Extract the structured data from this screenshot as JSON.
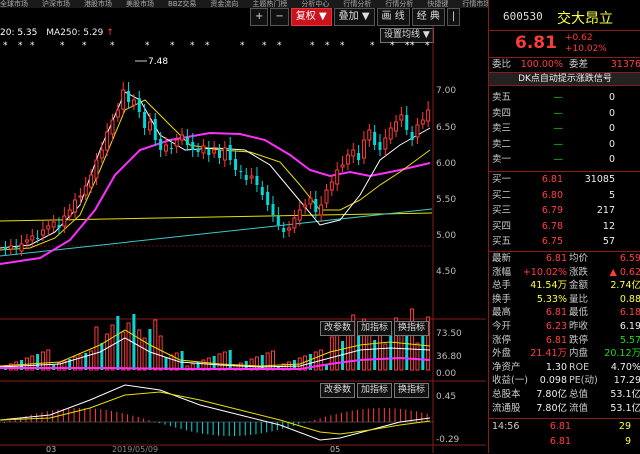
{
  "menu": [
    "全球市场",
    "沪深市场",
    "港股市场",
    "美股市场",
    "BBZ交易",
    "资金流向",
    "主题热门榜",
    "分析中心",
    "行情分析",
    "行情分析",
    "快捷键",
    "行情市场"
  ],
  "toolbar": {
    "plus": "+",
    "minus": "−",
    "fuquan": "复权",
    "diejia": "叠加",
    "huaxian": "画 线",
    "jingdian": "经 典",
    "lipin": "|"
  },
  "ma_legend": {
    "ma20": "20: 5.35",
    "ma250": "MA250: 5.29",
    "arrow": "↑"
  },
  "buttons": {
    "setting_ma": "设置均线",
    "change_param": "改参数",
    "add_indicator": "加指标",
    "switch_indicator": "换指标"
  },
  "price_axis": [
    "7.00",
    "6.50",
    "6.00",
    "5.50",
    "5.00",
    "4.50"
  ],
  "volume_axis": [
    "73.50",
    "36.80",
    "0.00"
  ],
  "macd_axis": [
    "0.45",
    "-0.29"
  ],
  "date_labels": [
    "03",
    "2019/05/09",
    "05"
  ],
  "high_label": "7.48",
  "stock": {
    "code": "600530",
    "name": "交大昂立",
    "price": "6.81",
    "change": "+0.62",
    "pct": "+10.02%"
  },
  "ratio_row": {
    "label1": "委比",
    "val1": "100.00%",
    "label2": "委差",
    "val2": "31376"
  },
  "signal_banner": "DK点自动提示涨跌信号",
  "sell_rows": [
    {
      "label": "卖五",
      "price": "—",
      "vol": "0"
    },
    {
      "label": "卖四",
      "price": "—",
      "vol": "0"
    },
    {
      "label": "卖三",
      "price": "—",
      "vol": "0"
    },
    {
      "label": "卖二",
      "price": "—",
      "vol": "0"
    },
    {
      "label": "卖一",
      "price": "—",
      "vol": "0"
    }
  ],
  "buy_rows": [
    {
      "label": "买一",
      "price": "6.81",
      "vol": "31085"
    },
    {
      "label": "买二",
      "price": "6.80",
      "vol": "5"
    },
    {
      "label": "买三",
      "price": "6.79",
      "vol": "217"
    },
    {
      "label": "买四",
      "price": "6.78",
      "vol": "12"
    },
    {
      "label": "买五",
      "price": "6.75",
      "vol": "57"
    }
  ],
  "stats": [
    {
      "l1": "最新",
      "v1": "6.81",
      "c1": "red",
      "l2": "均价",
      "v2": "6.59",
      "c2": "red"
    },
    {
      "l1": "涨幅",
      "v1": "+10.02%",
      "c1": "red",
      "l2": "涨跌",
      "v2": "▲ 0.62",
      "c2": "red"
    },
    {
      "l1": "总手",
      "v1": "41.54万",
      "c1": "yellow",
      "l2": "金额",
      "v2": "2.74亿",
      "c2": "yellow"
    },
    {
      "l1": "换手",
      "v1": "5.33%",
      "c1": "yellow",
      "l2": "量比",
      "v2": "0.88",
      "c2": "yellow"
    },
    {
      "l1": "最高",
      "v1": "6.81",
      "c1": "red",
      "l2": "最低",
      "v2": "6.18",
      "c2": "red"
    },
    {
      "l1": "今开",
      "v1": "6.23",
      "c1": "red",
      "l2": "昨收",
      "v2": "6.19",
      "c2": "white"
    },
    {
      "l1": "涨停",
      "v1": "6.81",
      "c1": "red",
      "l2": "跌停",
      "v2": "5.57",
      "c2": "green"
    },
    {
      "l1": "外盘",
      "v1": "21.41万",
      "c1": "red",
      "l2": "内盘",
      "v2": "20.12万",
      "c2": "green"
    },
    {
      "l1": "净资产",
      "v1": "1.30",
      "c1": "white",
      "l2": "ROE",
      "v2": "4.70%",
      "c2": "white"
    },
    {
      "l1": "收益(一)",
      "v1": "0.098",
      "c1": "white",
      "l2": "PE(动)",
      "v2": "17.29",
      "c2": "white"
    },
    {
      "l1": "总股本",
      "v1": "7.80亿",
      "c1": "white",
      "l2": "总值",
      "v2": "53.1亿",
      "c2": "white"
    },
    {
      "l1": "流通股",
      "v1": "7.80亿",
      "c1": "white",
      "l2": "流值",
      "v2": "53.1亿",
      "c2": "white"
    }
  ],
  "ticks": [
    {
      "time": "14:56",
      "price": "6.81",
      "vol": "29"
    },
    {
      "time": "",
      "price": "6.81",
      "vol": "9"
    }
  ],
  "colors": {
    "up": "#ff3c3c",
    "down": "#00d8d8",
    "ma_white": "#ffffff",
    "ma_yellow": "#e8e000",
    "ma_magenta": "#ff30ff",
    "ma_teal": "#40c8c8",
    "panel_border": "#8b1a1a"
  }
}
